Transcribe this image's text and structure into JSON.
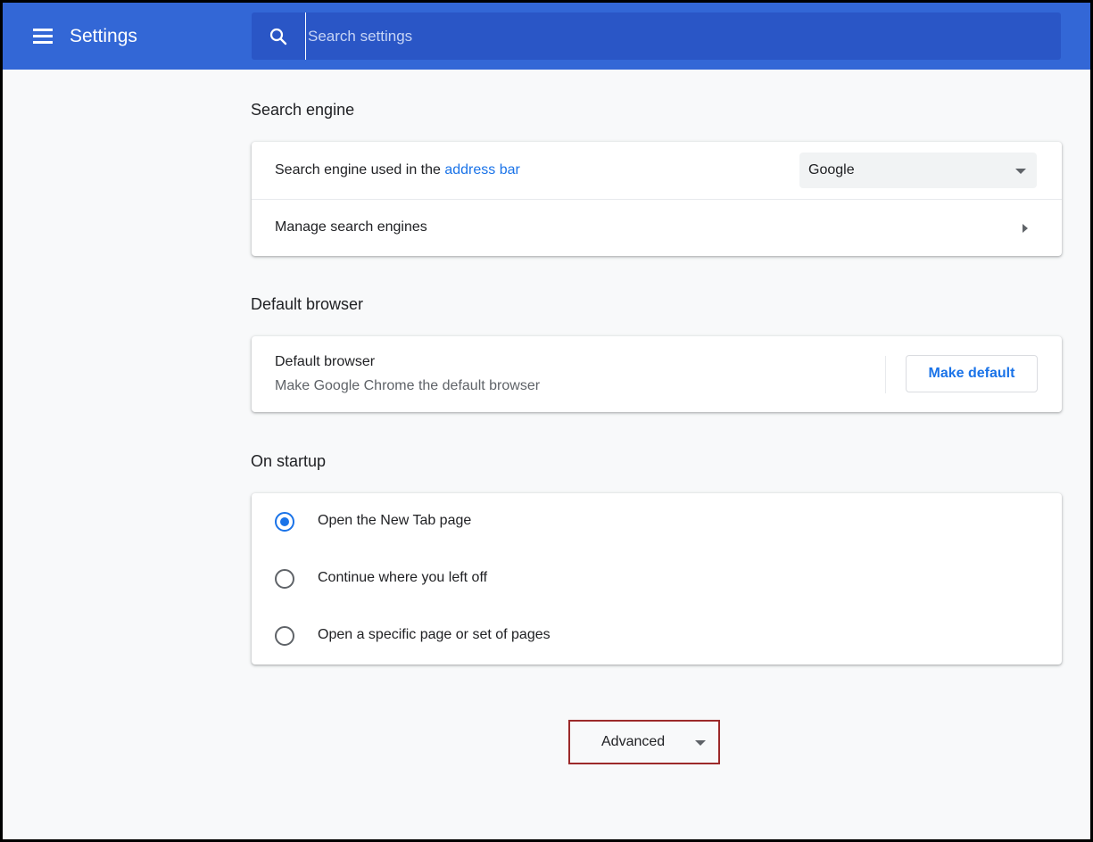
{
  "header": {
    "title": "Settings",
    "search_placeholder": "Search settings"
  },
  "search_engine": {
    "section_title": "Search engine",
    "used_in_prefix": "Search engine used in the ",
    "used_in_link": "address bar",
    "selected_engine": "Google",
    "manage_label": "Manage search engines"
  },
  "default_browser": {
    "section_title": "Default browser",
    "row_title": "Default browser",
    "row_subtitle": "Make Google Chrome the default browser",
    "button_label": "Make default"
  },
  "on_startup": {
    "section_title": "On startup",
    "options": [
      {
        "label": "Open the New Tab page",
        "checked": true
      },
      {
        "label": "Continue where you left off",
        "checked": false
      },
      {
        "label": "Open a specific page or set of pages",
        "checked": false
      }
    ]
  },
  "advanced": {
    "label": "Advanced",
    "highlight_color": "#9c2a2a"
  },
  "colors": {
    "header_bg": "#3367d6",
    "search_bg": "#2a56c6",
    "accent": "#1a73e8",
    "page_bg": "#f8f9fa"
  },
  "icons": {
    "menu": "hamburger-menu-icon",
    "search": "search-icon",
    "dropdown": "caret-down-icon",
    "submenu": "caret-right-icon"
  }
}
